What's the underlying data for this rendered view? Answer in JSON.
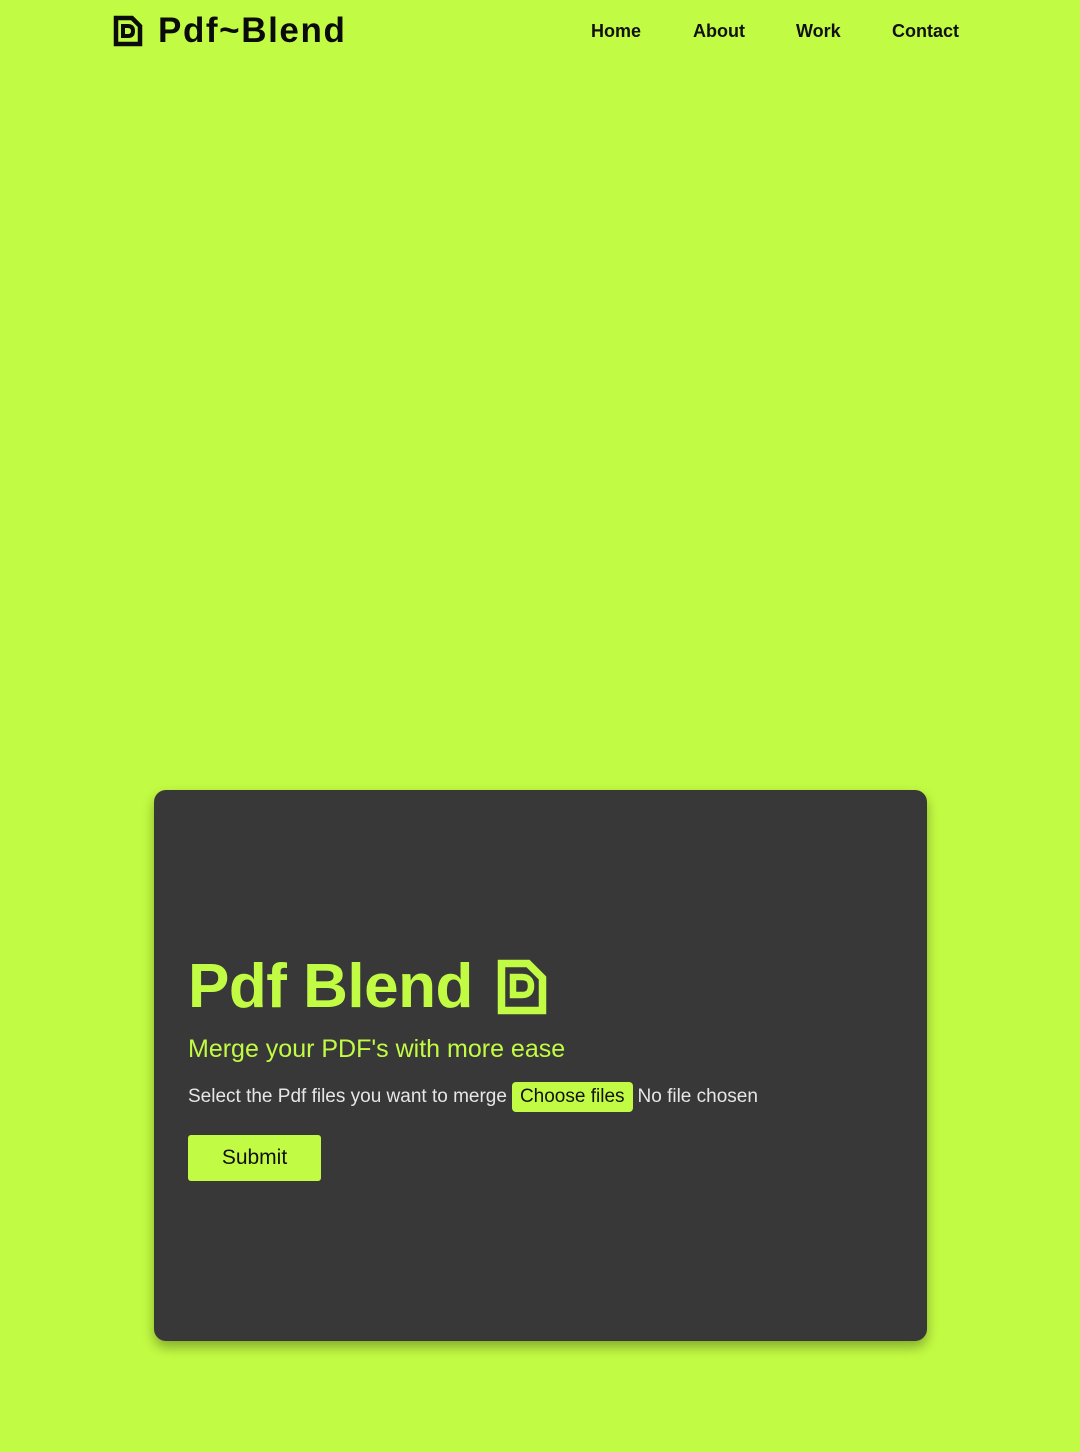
{
  "navbar": {
    "brand": "Pdf~Blend",
    "brand_icon": "pdf-file-icon",
    "links": [
      "Home",
      "About",
      "Work",
      "Contact"
    ]
  },
  "hero": {
    "title": "Pdf Blend",
    "title_icon": "pdf-file-icon",
    "subtitle": "Merge your PDF's with more ease",
    "file_prompt": "Select the Pdf files you want to merge",
    "choose_label": "Choose files",
    "file_status": "No file chosen",
    "submit_label": "Submit"
  },
  "colors": {
    "accent": "#c2fb43",
    "card_background": "#383838",
    "text_dark": "#111111"
  }
}
